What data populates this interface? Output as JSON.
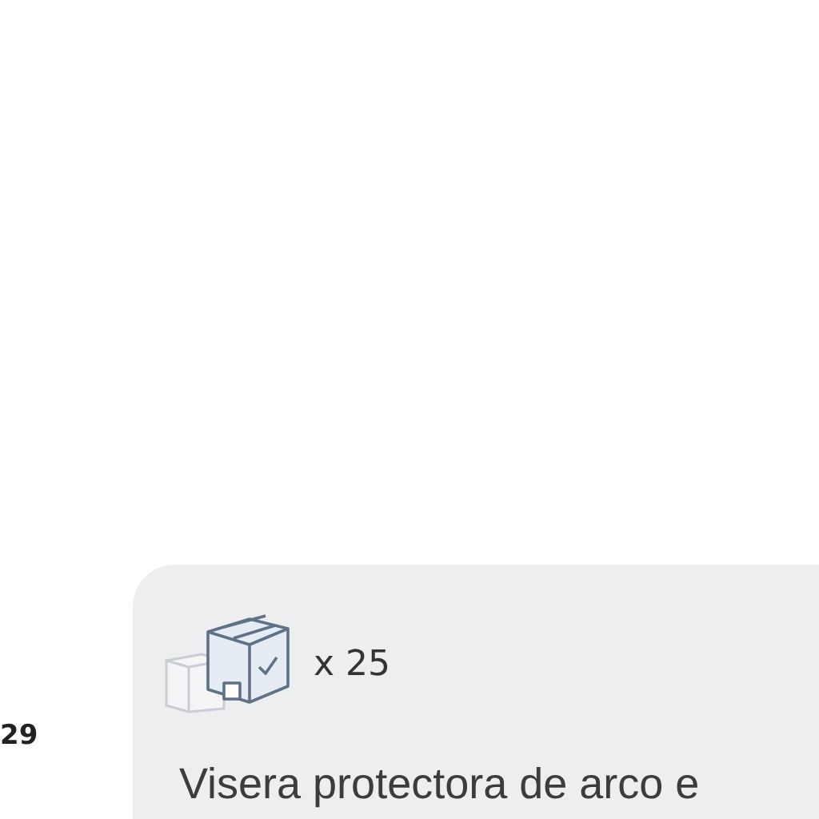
{
  "side_number": "29",
  "card": {
    "quantity": "x 25",
    "title": "Visera protectora de arco e"
  }
}
